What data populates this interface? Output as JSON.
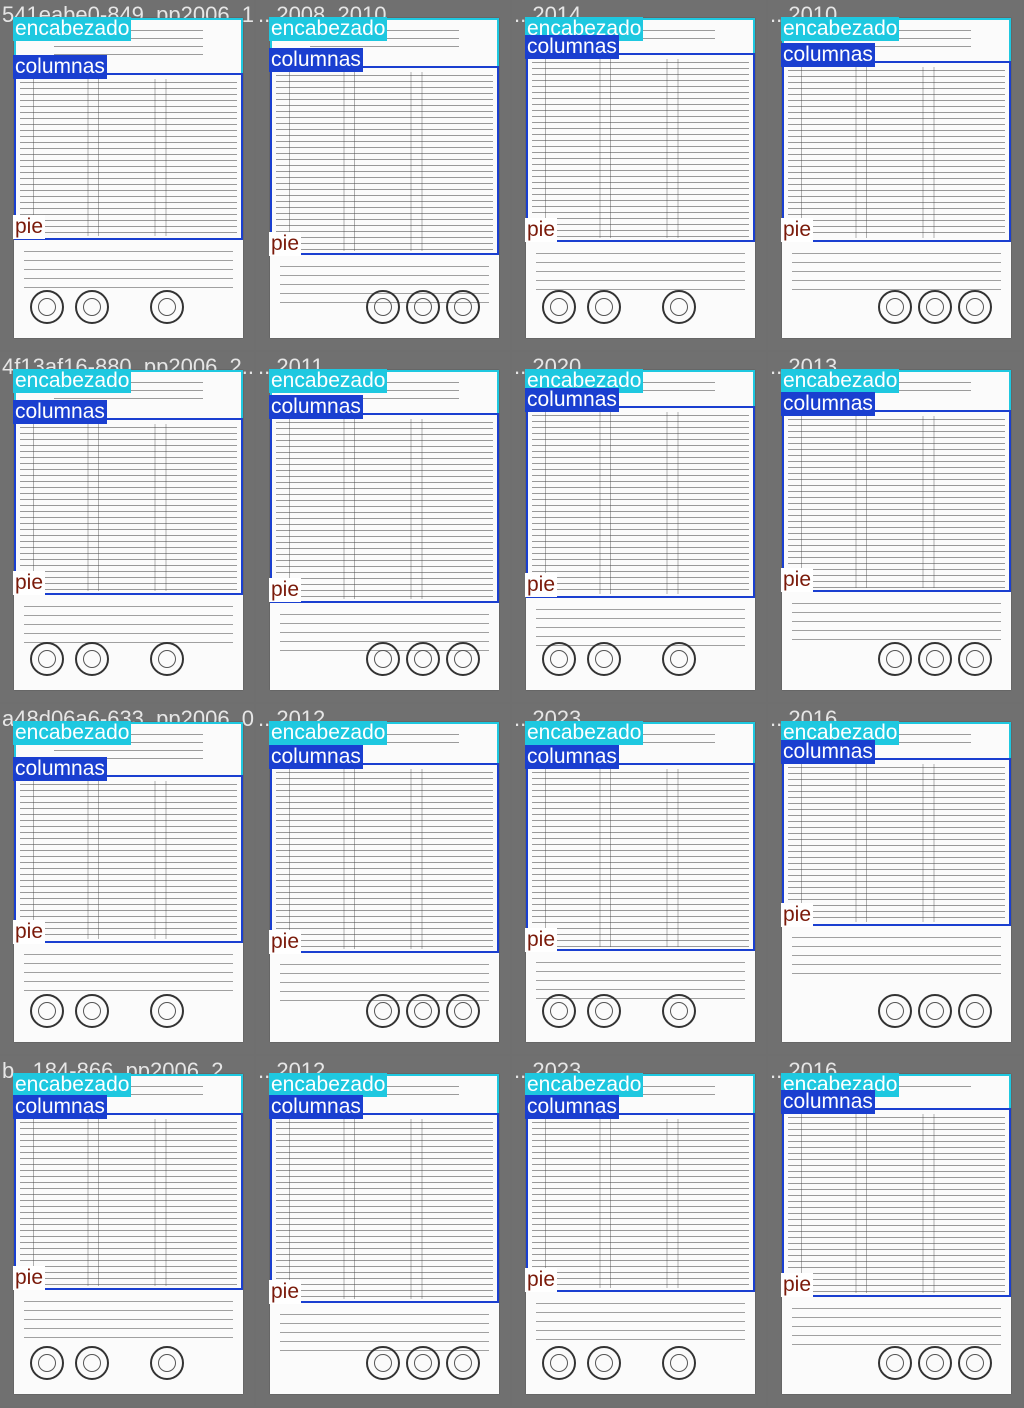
{
  "colors": {
    "background": "#6f6f6f",
    "encabezado": "#1ec8e0",
    "columnas": "#1a3fd0",
    "pie": "#7a1a0a"
  },
  "labels": {
    "encabezado": "encabezado",
    "columnas": "columnas",
    "pie": "pie"
  },
  "tiles": [
    {
      "filename": "541eabe0-849_pp2006_1..."
    },
    {
      "filename": "...2008_2010..."
    },
    {
      "filename": "...2014..."
    },
    {
      "filename": "...2010..."
    },
    {
      "filename": "4f13af16-880_pp2006_2..."
    },
    {
      "filename": "...2011..."
    },
    {
      "filename": "...2020..."
    },
    {
      "filename": "...2013..."
    },
    {
      "filename": "a48d06a6-633_pp2006_0..."
    },
    {
      "filename": "...2012..."
    },
    {
      "filename": "...2023..."
    },
    {
      "filename": "...2016..."
    },
    {
      "filename": "b...184-866_pp2006_2..."
    },
    {
      "filename": "...2012..."
    },
    {
      "filename": "...2023..."
    },
    {
      "filename": "...2016..."
    }
  ]
}
